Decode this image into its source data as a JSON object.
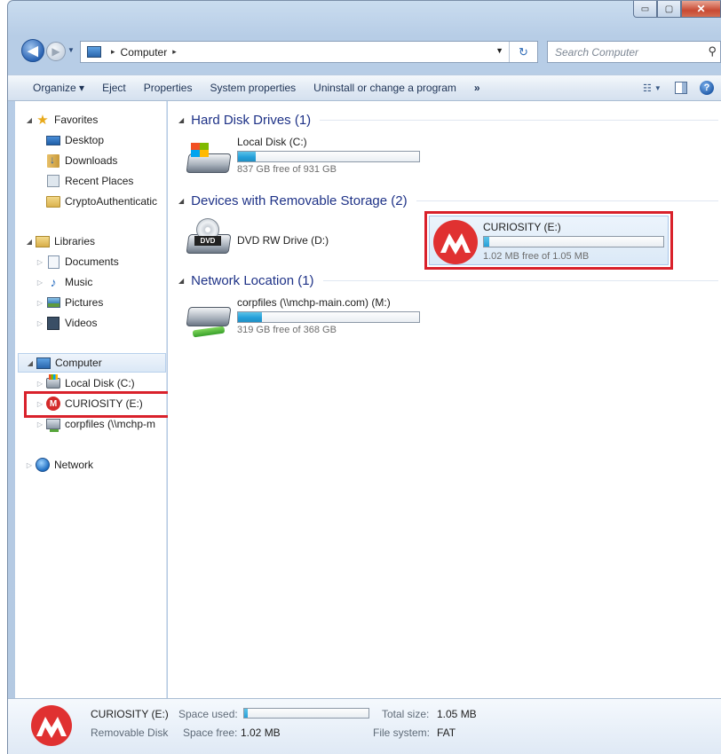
{
  "window": {
    "controls": {
      "minimize": "▭",
      "maximize": "▢",
      "close": "✕"
    }
  },
  "address_bar": {
    "back_glyph": "◀",
    "forward_glyph": "▶",
    "crumbs": [
      "Computer"
    ],
    "separator": "▸",
    "search_placeholder": "Search Computer"
  },
  "toolbar": {
    "organize": "Organize ▾",
    "eject": "Eject",
    "properties": "Properties",
    "system_properties": "System properties",
    "uninstall": "Uninstall or change a program",
    "more": "»"
  },
  "nav": {
    "favorites": "Favorites",
    "desktop": "Desktop",
    "downloads": "Downloads",
    "recent_places": "Recent Places",
    "crypto": "CryptoAuthenticatic",
    "libraries": "Libraries",
    "documents": "Documents",
    "music": "Music",
    "pictures": "Pictures",
    "videos": "Videos",
    "computer": "Computer",
    "local_disk": "Local Disk (C:)",
    "curiosity": "CURIOSITY (E:)",
    "corpfiles": "corpfiles (\\\\mchp-m",
    "network": "Network"
  },
  "content": {
    "groups": {
      "hdd": "Hard Disk Drives (1)",
      "removable": "Devices with Removable Storage (2)",
      "network": "Network Location (1)"
    },
    "drives": {
      "c": {
        "name": "Local Disk (C:)",
        "free": "837 GB free of 931 GB",
        "used_fraction": 0.1
      },
      "dvd": {
        "name": "DVD RW Drive (D:)",
        "badge": "DVD"
      },
      "e": {
        "name": "CURIOSITY (E:)",
        "free": "1.02 MB free of 1.05 MB",
        "used_fraction": 0.03
      },
      "m": {
        "name": "corpfiles (\\\\mchp-main.com) (M:)",
        "free": "319 GB free of 368 GB",
        "used_fraction": 0.13
      }
    }
  },
  "details": {
    "name": "CURIOSITY (E:)",
    "type": "Removable Disk",
    "space_used_label": "Space used:",
    "space_free_label": "Space free:",
    "space_free_value": "1.02 MB",
    "total_size_label": "Total size:",
    "total_size_value": "1.05 MB",
    "file_system_label": "File system:",
    "file_system_value": "FAT",
    "used_fraction": 0.03
  }
}
